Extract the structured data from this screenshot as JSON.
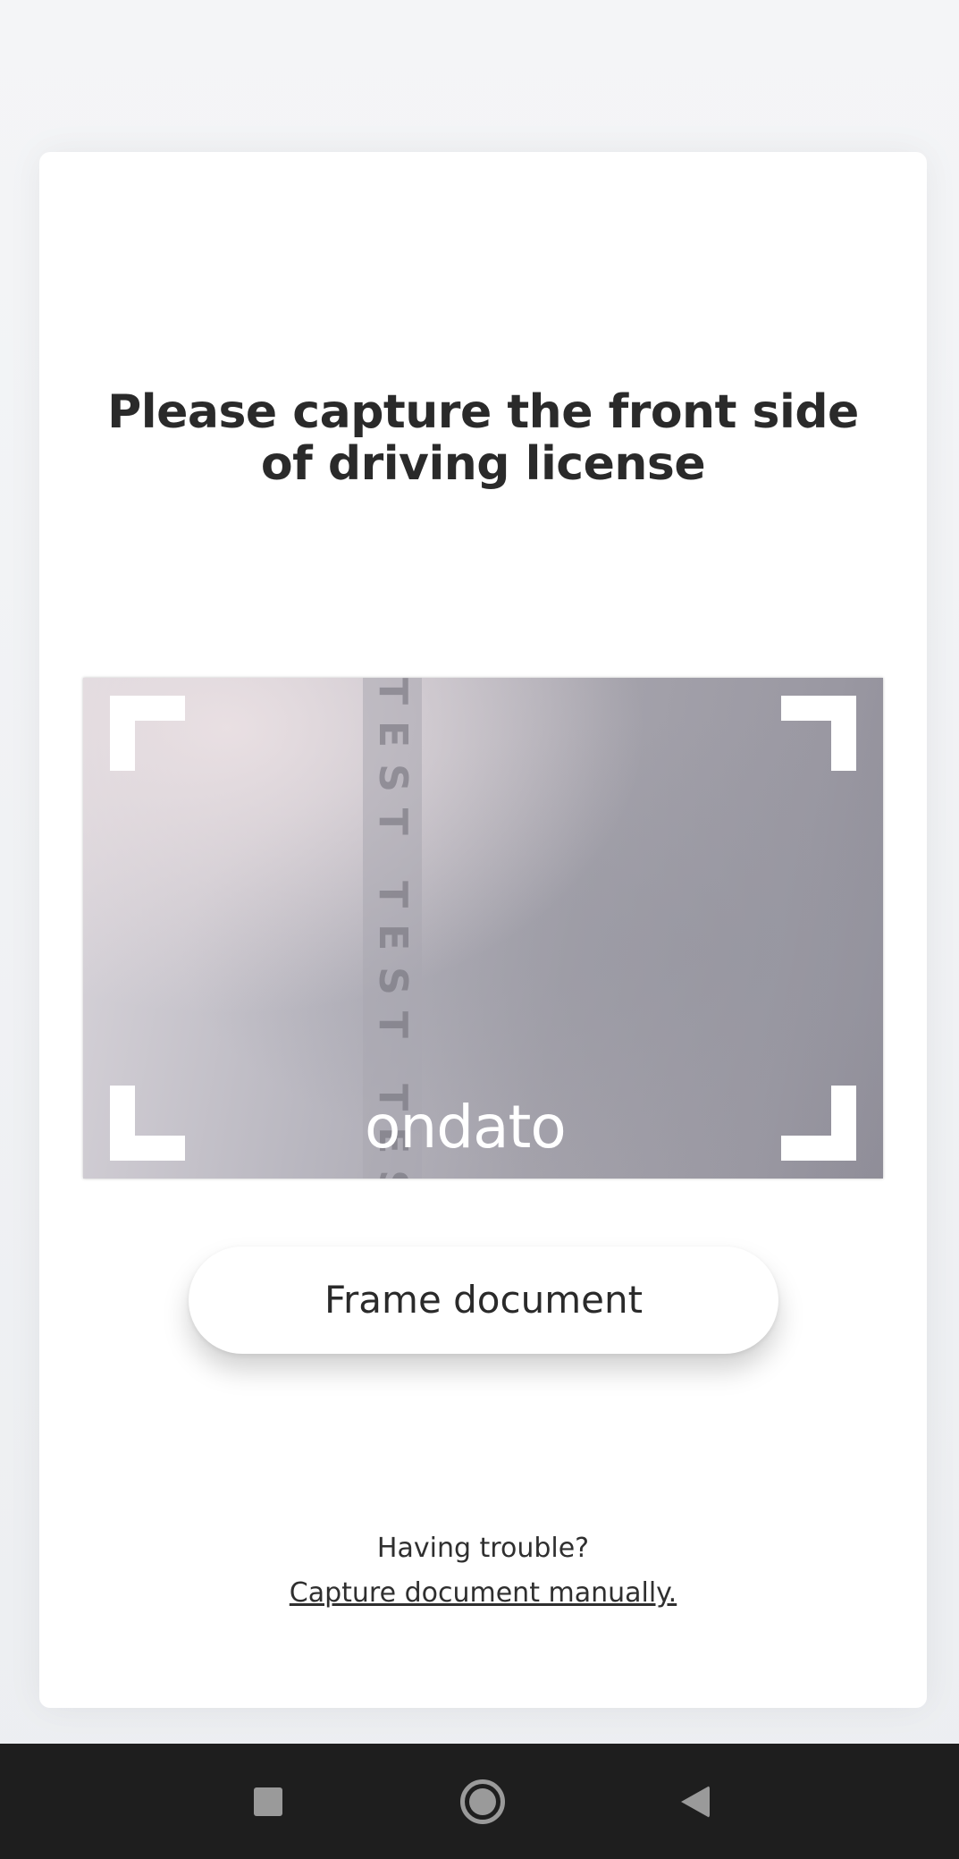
{
  "page": {
    "title_line": "Please capture the front side of driving license"
  },
  "camera": {
    "watermark": "TEST TEST TES",
    "logo": "ondato"
  },
  "actions": {
    "frame_button_label": "Frame document",
    "trouble_text": "Having trouble?",
    "manual_link_label": "Capture document manually."
  },
  "navbar": {
    "icons": [
      "recents-square-icon",
      "home-circle-icon",
      "back-triangle-icon"
    ]
  },
  "colors": {
    "text_dark": "#2a2a2a",
    "card_bg": "#ffffff",
    "navbar_bg": "#1e1e1e",
    "nav_icon": "#9a9a9a"
  }
}
